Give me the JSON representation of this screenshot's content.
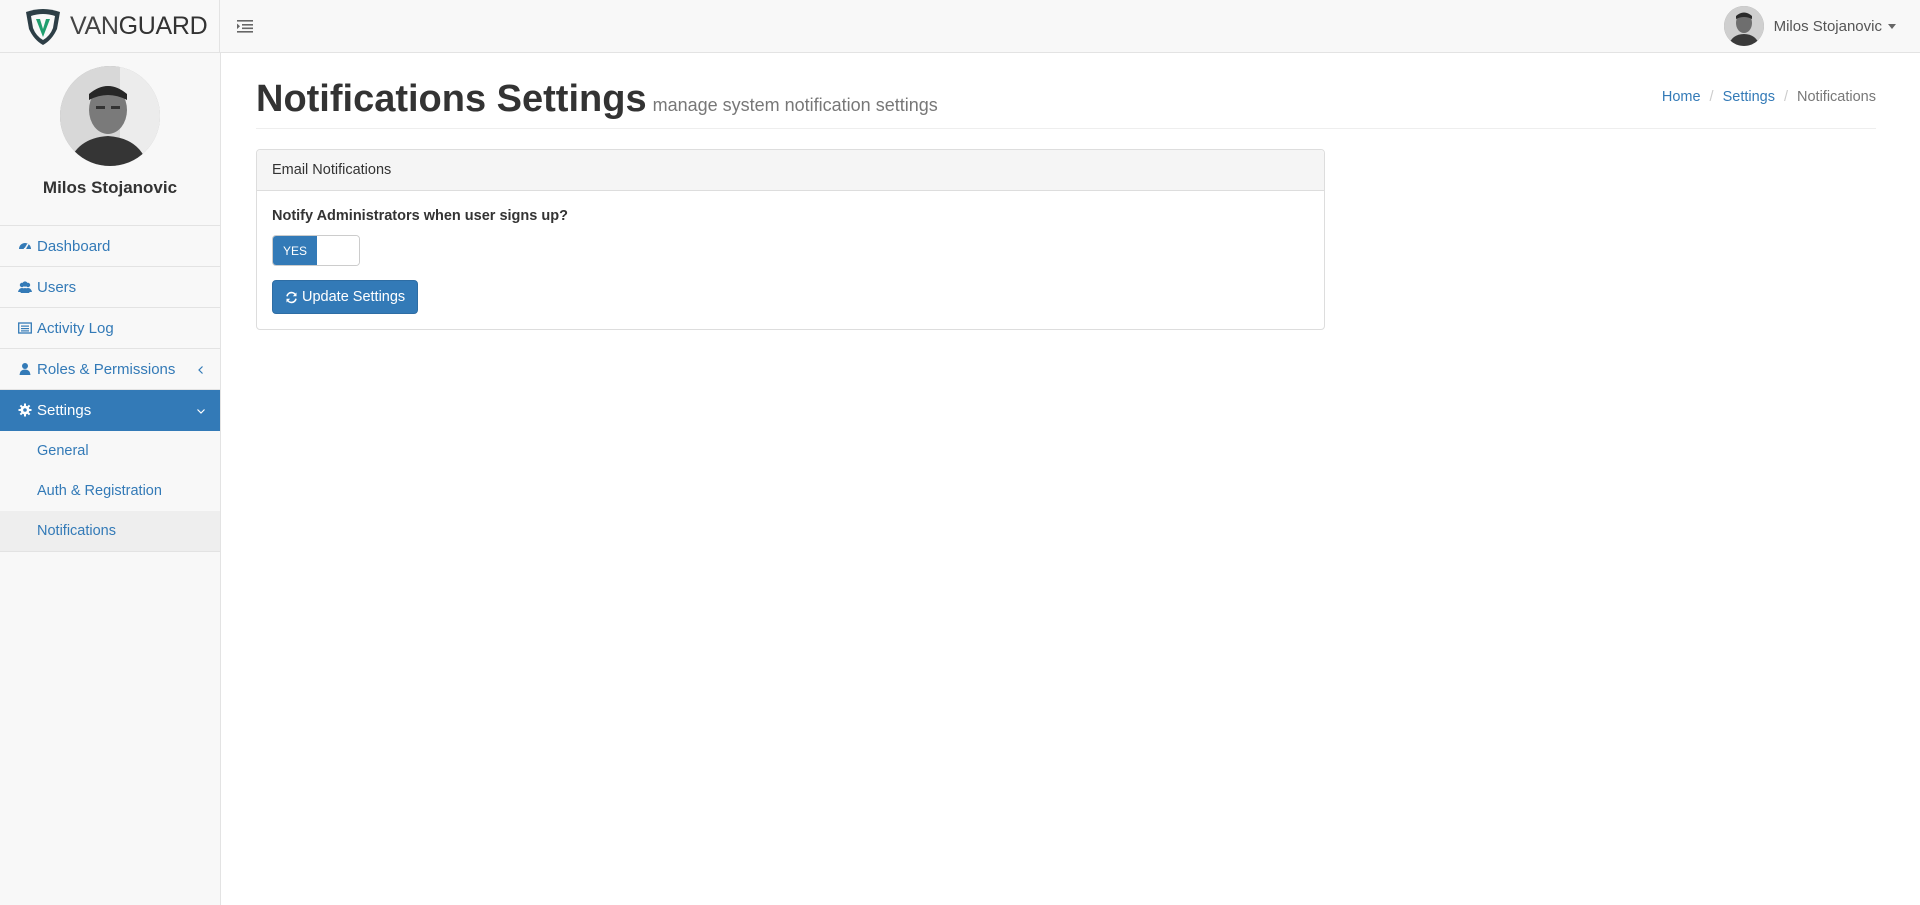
{
  "brand": {
    "part1": "VAN",
    "part2": "GUARD"
  },
  "topbar": {
    "user_name": "Milos Stojanovic"
  },
  "sidebar": {
    "profile_name": "Milos Stojanovic",
    "items": [
      {
        "label": "Dashboard",
        "icon": "dashboard-icon"
      },
      {
        "label": "Users",
        "icon": "users-icon"
      },
      {
        "label": "Activity Log",
        "icon": "list-icon"
      },
      {
        "label": "Roles & Permissions",
        "icon": "user-icon"
      },
      {
        "label": "Settings",
        "icon": "gear-icon"
      }
    ],
    "settings_sub": [
      "General",
      "Auth & Registration",
      "Notifications"
    ]
  },
  "page": {
    "title": "Notifications Settings",
    "subtitle": "manage system notification settings"
  },
  "breadcrumb": {
    "home": "Home",
    "settings": "Settings",
    "current": "Notifications"
  },
  "panel": {
    "heading": "Email Notifications",
    "question": "Notify Administrators when user signs up?",
    "toggle_on_label": "YES",
    "button_label": "Update Settings"
  },
  "colors": {
    "primary": "#337ab7",
    "accent_green": "#1f9e6e"
  }
}
